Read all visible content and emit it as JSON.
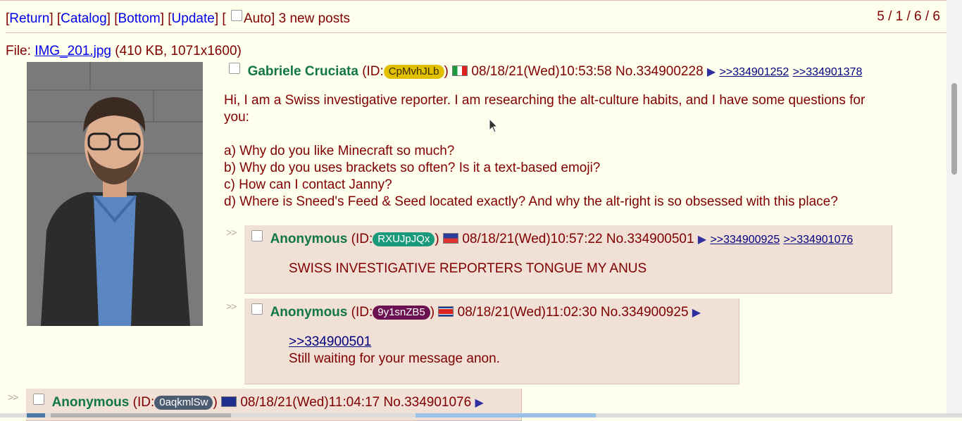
{
  "nav": {
    "return_label": "Return",
    "catalog_label": "Catalog",
    "bottom_label": "Bottom",
    "update_label": "Update",
    "auto_label": "Auto",
    "new_posts": "3 new posts",
    "stats": "5 / 1 / 6 / 6"
  },
  "file": {
    "prefix": "File:",
    "name": "IMG_201.jpg",
    "meta": "(410 KB, 1071x1600)"
  },
  "op": {
    "name": "Gabriele Cruciata",
    "id_prefix": "(ID:",
    "id": "CpMvhJLb",
    "id_suffix": ")",
    "datetime": "08/18/21(Wed)10:53:58",
    "number": "No.334900228",
    "backlinks": [
      ">>334901252",
      ">>334901378"
    ],
    "message_lines": [
      "Hi, I am a Swiss investigative reporter. I am researching the alt-culture habits, and I have some questions for",
      "you:",
      "",
      "a) Why do you like Minecraft so much?",
      "b) Why do you uses brackets so often? Is it a text-based emoji?",
      "c) How can I contact Janny?",
      "d) Where is Sneed's Feed & Seed located exactly? And why the alt-right is so obsessed with this place?"
    ]
  },
  "replies": [
    {
      "name": "Anonymous",
      "id_prefix": "(ID:",
      "id": "RXUJpJQx",
      "id_suffix": ")",
      "datetime": "08/18/21(Wed)10:57:22",
      "number": "No.334900501",
      "backlinks": [
        ">>334900925",
        ">>334901076"
      ],
      "quote": "",
      "message": "SWISS INVESTIGATIVE REPORTERS TONGUE MY ANUS"
    },
    {
      "name": "Anonymous",
      "id_prefix": "(ID:",
      "id": "9y1snZB5",
      "id_suffix": ")",
      "datetime": "08/18/21(Wed)11:02:30",
      "number": "No.334900925",
      "backlinks": [],
      "quote": ">>334900501",
      "message": "Still waiting for your message anon."
    },
    {
      "name": "Anonymous",
      "id_prefix": "(ID:",
      "id": "0aqkmlSw",
      "id_suffix": ")",
      "datetime": "08/18/21(Wed)11:04:17",
      "number": "No.334901076",
      "backlinks": [],
      "quote": "",
      "message": ""
    }
  ],
  "side_arrows": ">>",
  "arrow_glyph": "▶",
  "colors": {
    "page_bg": "#ffffee",
    "reply_bg": "#f0e0d6",
    "text": "#800000",
    "name": "#117743",
    "id_badge_op": "#e0c000",
    "id_badge_1": "#1a9a7a",
    "id_badge_2": "#6b1050",
    "id_badge_3": "#4b5b72"
  },
  "icons": {
    "op_flag": "italy-flag-icon",
    "reply1_flag": "region-flag-icon",
    "reply2_flag": "north-korea-flag-icon",
    "reply3_flag": "australia-flag-icon",
    "post_menu": "post-menu-arrow-icon"
  }
}
